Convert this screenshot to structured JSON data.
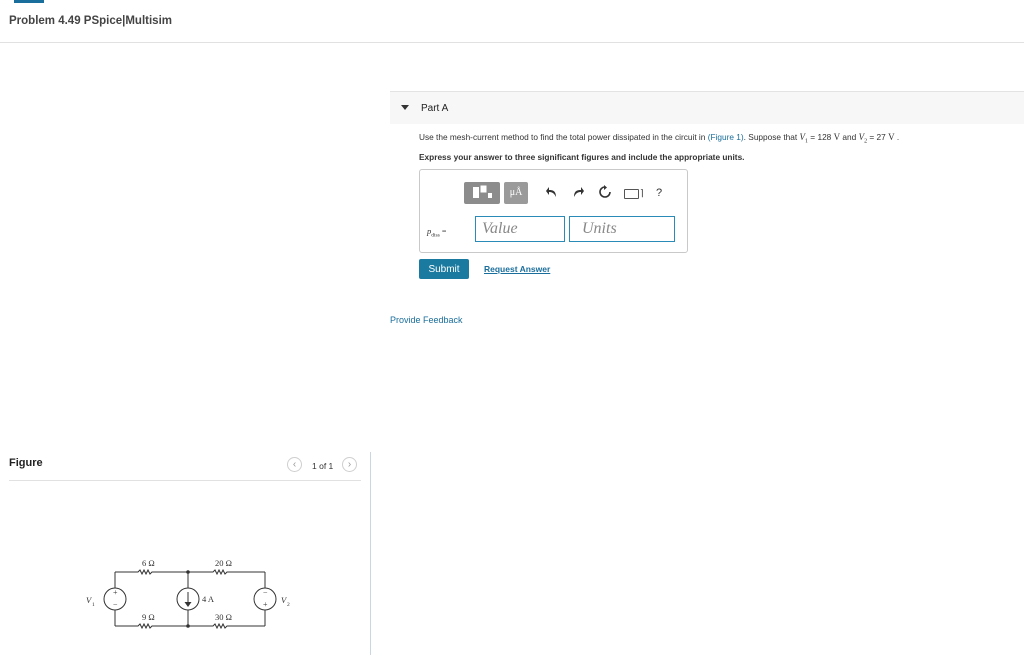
{
  "header": {
    "title": "Problem 4.49 PSpice|Multisim"
  },
  "part": {
    "label": "Part A",
    "question_prefix": "Use the mesh-current method to find the total power dissipated in the circuit in ",
    "figure_link": "(Figure 1)",
    "question_mid": ". Suppose that ",
    "v1_symbol": "V",
    "v1_sub": "1",
    "v1_value": " = 128 ",
    "v1_unit": "V",
    "and_text": " and ",
    "v2_symbol": "V",
    "v2_sub": "2",
    "v2_value": " = 27 ",
    "v2_unit": "V",
    "question_end": " .",
    "instruction": "Express your answer to three significant figures and include the appropriate units.",
    "answer_label_symbol": "p",
    "answer_label_sub": "diss",
    "answer_label_eq": " =",
    "value_placeholder": "Value",
    "units_placeholder": "Units",
    "toolbar": {
      "units_button": "μÅ",
      "undo_icon": "undo-icon",
      "redo_icon": "redo-icon",
      "reset_icon": "reset-icon",
      "keyboard_icon": "keyboard-icon",
      "help": "?"
    },
    "submit_label": "Submit",
    "request_answer_label": "Request Answer"
  },
  "feedback_label": "Provide Feedback",
  "figure": {
    "label": "Figure",
    "pager": "1 of 1",
    "circuit": {
      "top_left_resistor": "6 Ω",
      "top_right_resistor": "20 Ω",
      "bottom_left_resistor": "9 Ω",
      "bottom_right_resistor": "30 Ω",
      "current_source": "4 A",
      "left_source": "V",
      "left_source_sub": "1",
      "right_source": "V",
      "right_source_sub": "2"
    }
  },
  "colors": {
    "link": "#1a6e9c",
    "submit": "#1b7aa0",
    "input_border": "#2a8ab8"
  }
}
